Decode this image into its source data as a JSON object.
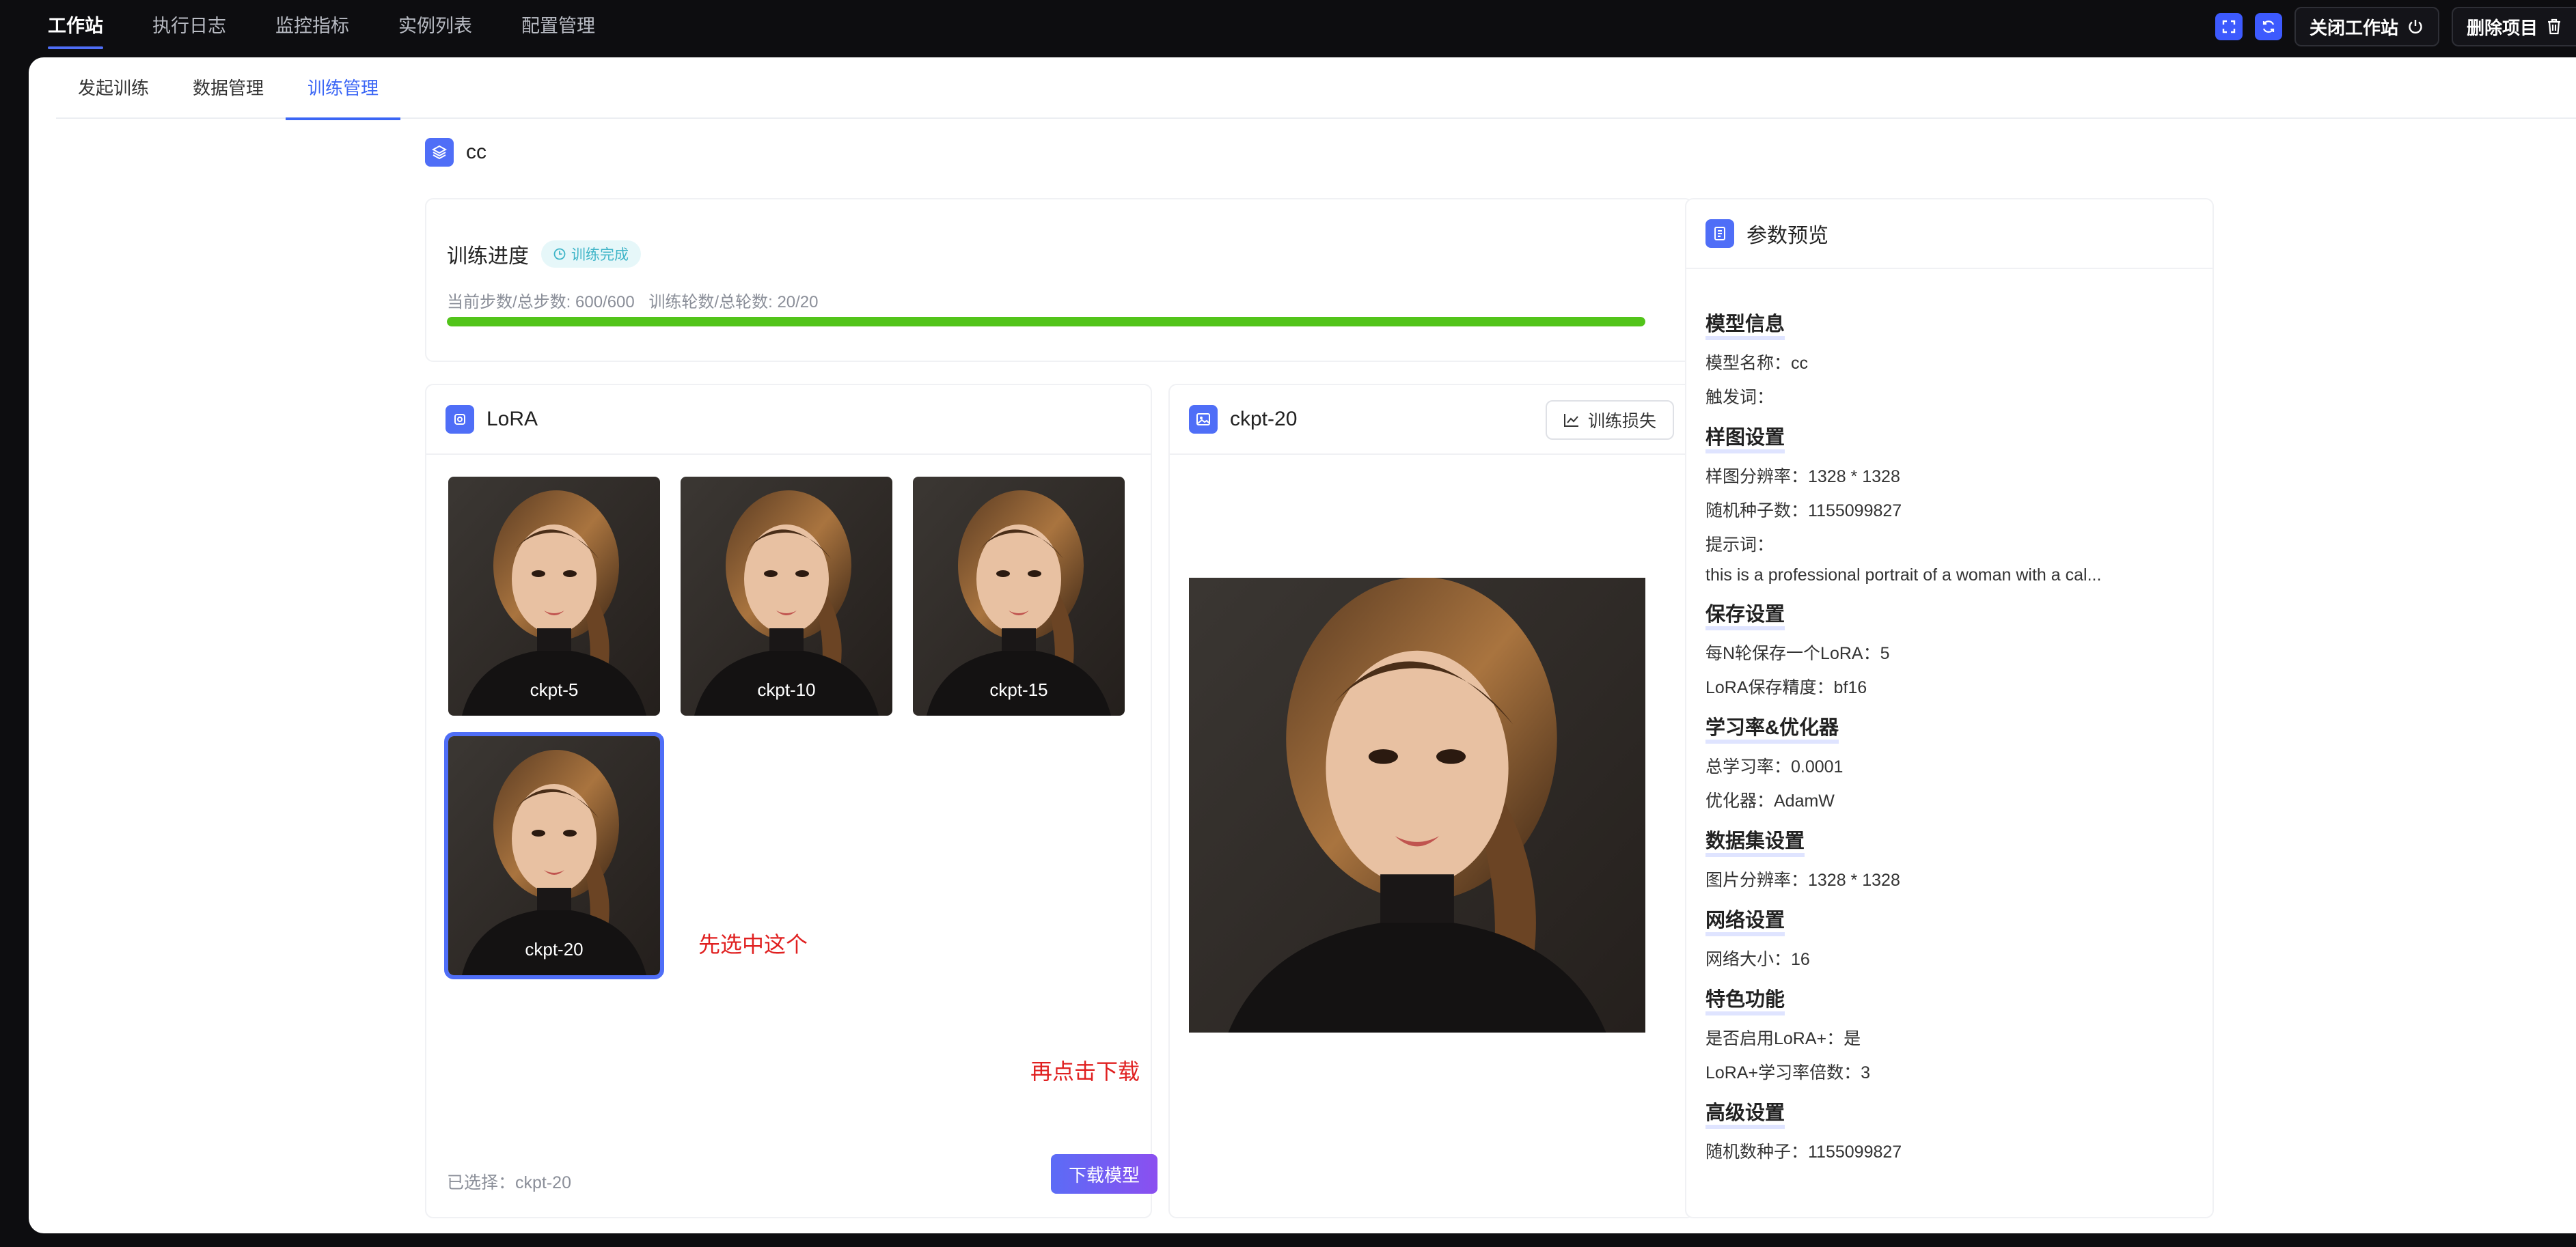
{
  "topnav": {
    "items": [
      {
        "label": "工作站",
        "active": true
      },
      {
        "label": "执行日志"
      },
      {
        "label": "监控指标"
      },
      {
        "label": "实例列表"
      },
      {
        "label": "配置管理"
      }
    ],
    "close_label": "关闭工作站",
    "delete_label": "删除项目",
    "accent": "#3d5afe"
  },
  "subtabs": [
    {
      "label": "发起训练"
    },
    {
      "label": "数据管理"
    },
    {
      "label": "训练管理",
      "active": true
    }
  ],
  "project": {
    "name": "cc"
  },
  "progress": {
    "title": "训练进度",
    "status": "训练完成",
    "steps_text": "当前步数/总步数: 600/600",
    "epochs_text": "训练轮数/总轮数: 20/20",
    "percent": 100,
    "bar_color": "#52c41a"
  },
  "lora": {
    "title": "LoRA",
    "checkpoints": [
      {
        "label": "ckpt-5"
      },
      {
        "label": "ckpt-10"
      },
      {
        "label": "ckpt-15"
      },
      {
        "label": "ckpt-20",
        "selected": true
      }
    ],
    "annotation_select": "先选中这个",
    "annotation_download": "再点击下载",
    "selected_text": "已选择：ckpt-20",
    "download_label": "下载模型"
  },
  "preview": {
    "title": "ckpt-20",
    "loss_label": "训练损失"
  },
  "params": {
    "title": "参数预览",
    "sections": [
      {
        "title": "模型信息",
        "rows": [
          "模型名称：cc",
          "触发词："
        ]
      },
      {
        "title": "样图设置",
        "rows": [
          "样图分辨率：1328 * 1328",
          "随机种子数：1155099827",
          "提示词：",
          "this is a professional portrait of a woman with a cal..."
        ]
      },
      {
        "title": "保存设置",
        "rows": [
          "每N轮保存一个LoRA：5",
          "LoRA保存精度：bf16"
        ]
      },
      {
        "title": "学习率&优化器",
        "rows": [
          "总学习率：0.0001",
          "优化器：AdamW"
        ]
      },
      {
        "title": "数据集设置",
        "rows": [
          "图片分辨率：1328 * 1328"
        ]
      },
      {
        "title": "网络设置",
        "rows": [
          "网络大小：16"
        ]
      },
      {
        "title": "特色功能",
        "rows": [
          "是否启用LoRA+：是",
          "LoRA+学习率倍数：3"
        ]
      },
      {
        "title": "高级设置",
        "rows": [
          "随机数种子：1155099827"
        ]
      }
    ]
  }
}
